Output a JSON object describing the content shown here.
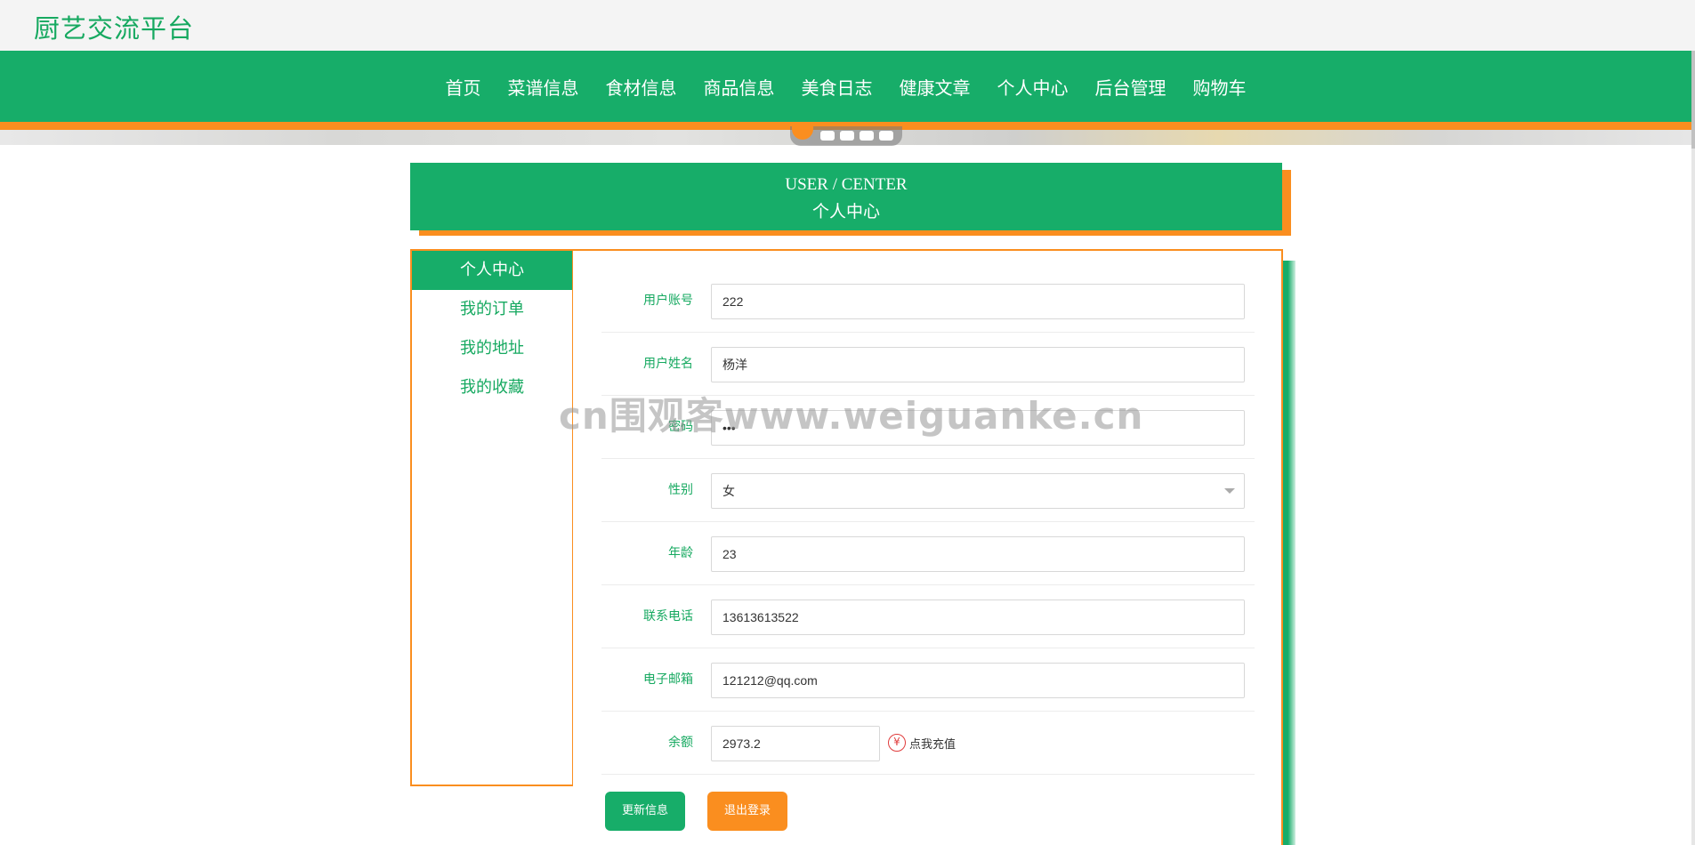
{
  "site": {
    "title": "厨艺交流平台"
  },
  "nav": {
    "items": [
      {
        "label": "首页"
      },
      {
        "label": "菜谱信息"
      },
      {
        "label": "食材信息"
      },
      {
        "label": "商品信息"
      },
      {
        "label": "美食日志"
      },
      {
        "label": "健康文章"
      },
      {
        "label": "个人中心"
      },
      {
        "label": "后台管理"
      },
      {
        "label": "购物车"
      }
    ]
  },
  "header": {
    "title_en": "USER / CENTER",
    "title_cn": "个人中心"
  },
  "sidebar": {
    "items": [
      {
        "label": "个人中心",
        "active": true
      },
      {
        "label": "我的订单",
        "active": false
      },
      {
        "label": "我的地址",
        "active": false
      },
      {
        "label": "我的收藏",
        "active": false
      }
    ]
  },
  "form": {
    "account": {
      "label": "用户账号",
      "value": "222"
    },
    "name": {
      "label": "用户姓名",
      "value": "杨洋"
    },
    "password": {
      "label": "密码",
      "value": "•••"
    },
    "gender": {
      "label": "性别",
      "value": "女"
    },
    "age": {
      "label": "年龄",
      "value": "23"
    },
    "phone": {
      "label": "联系电话",
      "value": "13613613522"
    },
    "email": {
      "label": "电子邮箱",
      "value": "121212@qq.com"
    },
    "balance": {
      "label": "余额",
      "value": "2973.2",
      "recharge_label": "点我充值",
      "recharge_icon": "yen-icon"
    }
  },
  "buttons": {
    "update": "更新信息",
    "logout": "退出登录"
  },
  "watermark": "cn围观客www.weiguanke.cn",
  "colors": {
    "primary": "#17ad69",
    "accent": "#fa8e1f"
  }
}
